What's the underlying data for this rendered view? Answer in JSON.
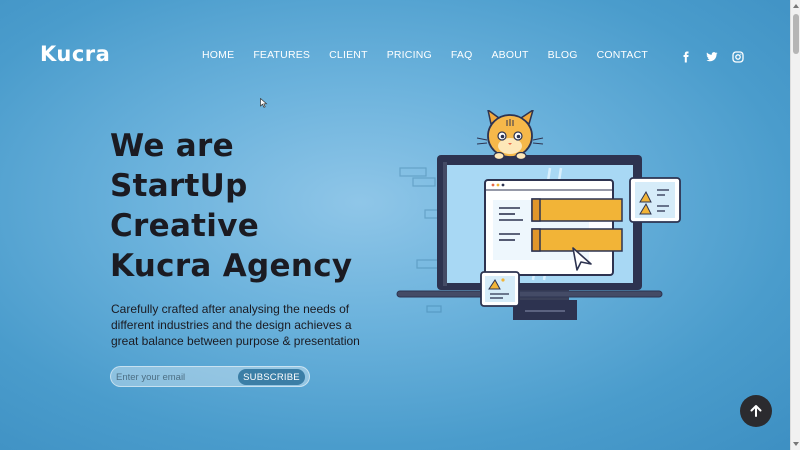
{
  "brand": {
    "logo": "Kucra"
  },
  "nav": {
    "items": [
      {
        "label": "HOME"
      },
      {
        "label": "FEATURES"
      },
      {
        "label": "CLIENT"
      },
      {
        "label": "PRICING"
      },
      {
        "label": "FAQ"
      },
      {
        "label": "ABOUT"
      },
      {
        "label": "BLOG"
      },
      {
        "label": "CONTACT"
      }
    ]
  },
  "socials": [
    {
      "icon": "facebook-icon"
    },
    {
      "icon": "twitter-icon"
    },
    {
      "icon": "instagram-icon"
    }
  ],
  "hero": {
    "title_lines": [
      "We are",
      "StartUp",
      "Creative",
      "Kucra Agency"
    ],
    "description": "Carefully crafted after analysing the needs of different industries and the design achieves a great balance between purpose & presentation",
    "subscribe": {
      "placeholder": "Enter your email",
      "button_label": "SUBSCRIBE"
    }
  },
  "colors": {
    "background": "#5aa8d6",
    "heading": "#1b1b22",
    "accent": "#f2b437",
    "button": "#3b7ea6"
  },
  "back_to_top": {
    "icon": "arrow-up-icon"
  }
}
